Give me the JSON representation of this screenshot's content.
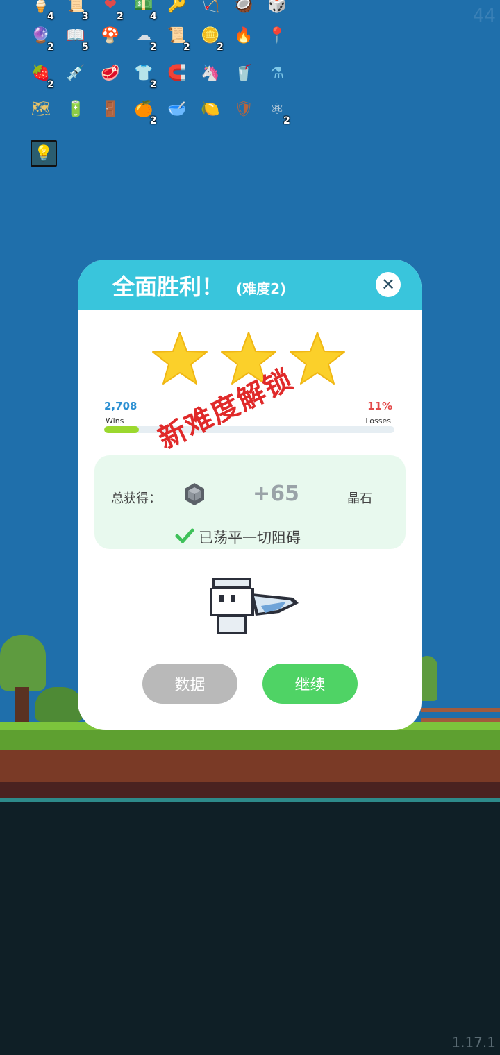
{
  "hud": {
    "corner_number": "44",
    "version": "1.17.1"
  },
  "inventory": [
    {
      "icon": "ice-cream-icon",
      "count": "4"
    },
    {
      "icon": "scroll-icon",
      "count": "3"
    },
    {
      "icon": "heart-icon",
      "count": "2"
    },
    {
      "icon": "cash-icon",
      "count": "4"
    },
    {
      "icon": "key-icon",
      "count": ""
    },
    {
      "icon": "bow-icon",
      "count": ""
    },
    {
      "icon": "coconut-icon",
      "count": ""
    },
    {
      "icon": "dice-icon",
      "count": ""
    },
    {
      "icon": "crystal-ball-icon",
      "count": "2"
    },
    {
      "icon": "book-icon",
      "count": "5"
    },
    {
      "icon": "mushroom-icon",
      "count": ""
    },
    {
      "icon": "cloud-icon",
      "count": "2"
    },
    {
      "icon": "paper-scroll-icon",
      "count": "2"
    },
    {
      "icon": "coins-icon",
      "count": "2"
    },
    {
      "icon": "torch-icon",
      "count": ""
    },
    {
      "icon": "map-pin-icon",
      "count": ""
    },
    {
      "icon": "strawberry-icon",
      "count": "2"
    },
    {
      "icon": "syringe-icon",
      "count": ""
    },
    {
      "icon": "meat-icon",
      "count": ""
    },
    {
      "icon": "shirt-icon",
      "count": "2"
    },
    {
      "icon": "magnet-icon",
      "count": ""
    },
    {
      "icon": "unicorn-icon",
      "count": ""
    },
    {
      "icon": "coconut-drink-icon",
      "count": ""
    },
    {
      "icon": "potion-flask-icon",
      "count": ""
    },
    {
      "icon": "map-note-icon",
      "count": ""
    },
    {
      "icon": "battery-icon",
      "count": ""
    },
    {
      "icon": "door-icon",
      "count": ""
    },
    {
      "icon": "orange-slice-icon",
      "count": "2"
    },
    {
      "icon": "mortar-icon",
      "count": ""
    },
    {
      "icon": "lime-icon",
      "count": ""
    },
    {
      "icon": "shield-icon",
      "count": ""
    },
    {
      "icon": "molecule-icon",
      "count": "2"
    },
    {
      "icon": "lightbulb-card-icon",
      "count": ""
    }
  ],
  "modal": {
    "title": "全面胜利！",
    "difficulty": "(难度2)",
    "close_label": "✕",
    "stars": 3,
    "wins_value": "2,708",
    "wins_label": "Wins",
    "losses_value": "11%",
    "losses_label": "Losses",
    "progress_fraction": 0.12,
    "unlock_stamp": "新难度解锁",
    "reward_label": "总获得：",
    "reward_amount": "+65",
    "reward_unit": "晶石",
    "cleared_text": "已荡平一切阻碍",
    "data_button": "数据",
    "continue_button": "继续"
  },
  "colors": {
    "sky": "#1f6fab",
    "header": "#39c5dc",
    "continue": "#4fd365",
    "data_btn": "#b9b9b9",
    "star": "#fbd02a"
  }
}
